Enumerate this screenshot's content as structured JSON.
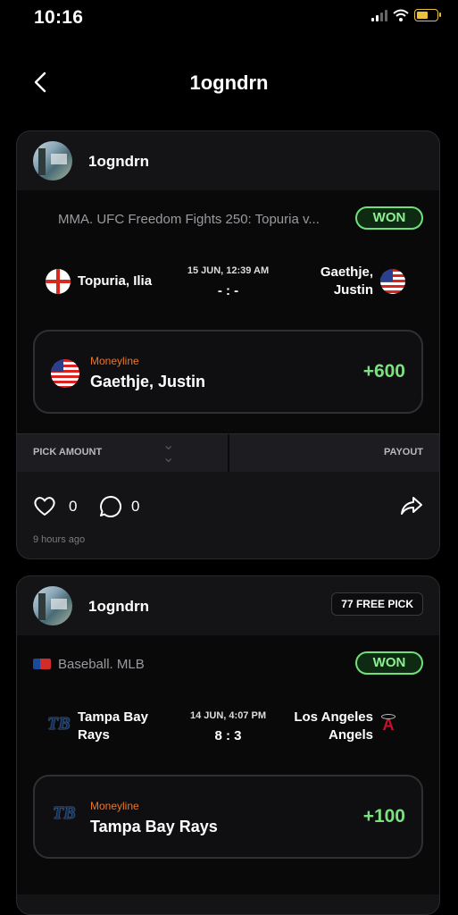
{
  "status": {
    "time": "10:16"
  },
  "header": {
    "title": "1ogndrn"
  },
  "cards": [
    {
      "username": "1ogndrn",
      "league": "MMA. UFC Freedom Fights 250: Topuria v...",
      "result": "WON",
      "home": "Topuria, Ilia",
      "away_line1": "Gaethje,",
      "away_line2": "Justin",
      "date": "15 JUN, 12:39 AM",
      "score": "- : -",
      "pick_type": "Moneyline",
      "pick_name": "Gaethje, Justin",
      "odds": "+600",
      "amount_label": "PICK AMOUNT",
      "payout_label": "PAYOUT",
      "likes": "0",
      "comments": "0",
      "ago": "9 hours ago"
    },
    {
      "username": "1ogndrn",
      "badge": "77 FREE PICK",
      "league": "Baseball. MLB",
      "result": "WON",
      "home_line1": "Tampa Bay",
      "home_line2": "Rays",
      "away_line1": "Los Angeles",
      "away_line2": "Angels",
      "date": "14 JUN, 4:07 PM",
      "score": "8 : 3",
      "pick_type": "Moneyline",
      "pick_name": "Tampa Bay Rays",
      "odds": "+100"
    }
  ],
  "colors": {
    "won": "#8ef092",
    "odds": "#7be07e",
    "pick_type": "#e8762b"
  }
}
